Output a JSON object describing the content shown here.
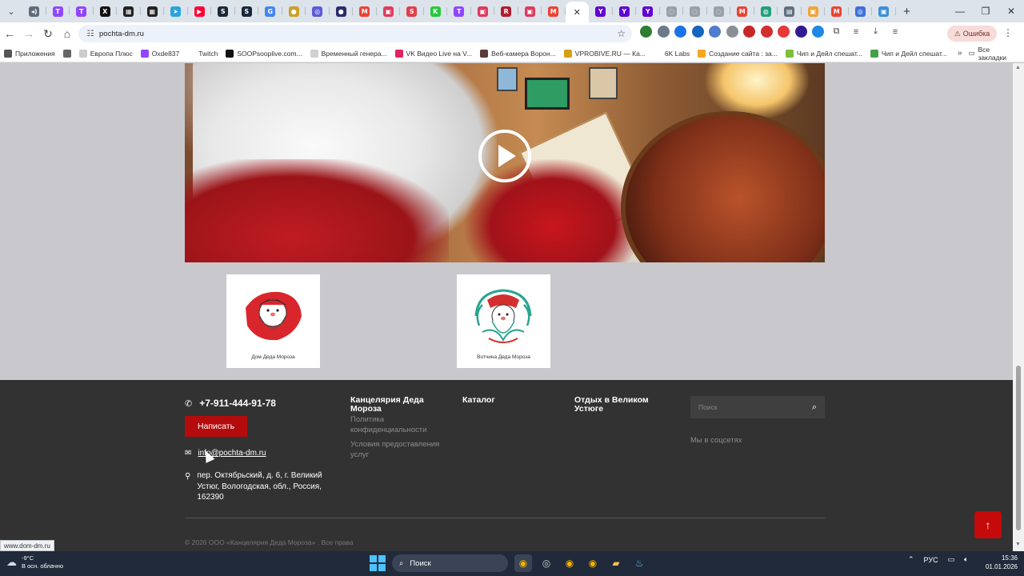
{
  "browser": {
    "url": "pochta-dm.ru",
    "errors_label": "Ошибка",
    "tabs": [
      {
        "icon": "audio-icon",
        "color": "#5f6b7a",
        "glyph": "◂)"
      },
      {
        "icon": "twitch-icon",
        "color": "#9146ff",
        "glyph": "T"
      },
      {
        "icon": "twitch-icon",
        "color": "#9146ff",
        "glyph": "T"
      },
      {
        "icon": "x-icon",
        "color": "#111111",
        "glyph": "X"
      },
      {
        "icon": "app-icon",
        "color": "#222222",
        "glyph": "▦"
      },
      {
        "icon": "app-icon",
        "color": "#222222",
        "glyph": "▦"
      },
      {
        "icon": "telegram-icon",
        "color": "#2aa3df",
        "glyph": "➤"
      },
      {
        "icon": "youtube-icon",
        "color": "#ff0033",
        "glyph": "▶"
      },
      {
        "icon": "steam-icon",
        "color": "#1b2838",
        "glyph": "S"
      },
      {
        "icon": "steam-icon",
        "color": "#1b2838",
        "glyph": "S"
      },
      {
        "icon": "google-icon",
        "color": "#4285f4",
        "glyph": "G"
      },
      {
        "icon": "coin-icon",
        "color": "#c9a227",
        "glyph": "●"
      },
      {
        "icon": "ring-icon",
        "color": "#5b5bd6",
        "glyph": "◎"
      },
      {
        "icon": "circle-icon",
        "color": "#2b2b6b",
        "glyph": "●"
      },
      {
        "icon": "gmail-icon",
        "color": "#ea4335",
        "glyph": "M"
      },
      {
        "icon": "app-icon",
        "color": "#e03a5c",
        "glyph": "▣"
      },
      {
        "icon": "app-icon",
        "color": "#e0404a",
        "glyph": "S"
      },
      {
        "icon": "kick-icon",
        "color": "#28c840",
        "glyph": "K"
      },
      {
        "icon": "twitch-icon",
        "color": "#9146ff",
        "glyph": "T"
      },
      {
        "icon": "app-icon",
        "color": "#e03a5c",
        "glyph": "▣"
      },
      {
        "icon": "app-icon",
        "color": "#b01e2e",
        "glyph": "R"
      },
      {
        "icon": "app-icon",
        "color": "#e03a5c",
        "glyph": "▣"
      },
      {
        "icon": "gmail-icon",
        "color": "#ea4335",
        "glyph": "M"
      },
      {
        "icon": "page-icon",
        "color": "#ffffff",
        "glyph": "",
        "active": true
      },
      {
        "icon": "yahoo-icon",
        "color": "#5f01d1",
        "glyph": "Y"
      },
      {
        "icon": "yahoo-icon",
        "color": "#5f01d1",
        "glyph": "Y"
      },
      {
        "icon": "yahoo-icon",
        "color": "#5f01d1",
        "glyph": "Y"
      },
      {
        "icon": "loading-icon",
        "color": "#9aa0a6",
        "glyph": "◌"
      },
      {
        "icon": "loading-icon",
        "color": "#9aa0a6",
        "glyph": "◌"
      },
      {
        "icon": "loading-icon",
        "color": "#9aa0a6",
        "glyph": "◌"
      },
      {
        "icon": "gmail-icon",
        "color": "#ea4335",
        "glyph": "M"
      },
      {
        "icon": "app-icon",
        "color": "#21a07a",
        "glyph": "◍"
      },
      {
        "icon": "app-icon",
        "color": "#607080",
        "glyph": "▤"
      },
      {
        "icon": "app-icon",
        "color": "#f2a33a",
        "glyph": "▣"
      },
      {
        "icon": "gmail-icon",
        "color": "#ea4335",
        "glyph": "M"
      },
      {
        "icon": "app-icon",
        "color": "#3b6fd8",
        "glyph": "◎"
      },
      {
        "icon": "app-icon",
        "color": "#3b8fd8",
        "glyph": "▣"
      }
    ],
    "extensions": [
      {
        "icon": "ext-green-icon",
        "color": "#2e7d32"
      },
      {
        "icon": "ext-translate-icon",
        "color": "#6d7a8a"
      },
      {
        "icon": "ext-blue-icon",
        "color": "#1a73e8"
      },
      {
        "icon": "ext-camera-icon",
        "color": "#1565c0"
      },
      {
        "icon": "ext-translator-icon",
        "color": "#4f7ccf"
      },
      {
        "icon": "ext-gray-icon",
        "color": "#8a8f96"
      },
      {
        "icon": "ext-red-icon",
        "color": "#c62828"
      },
      {
        "icon": "ext-pdf-icon",
        "color": "#d32f2f"
      },
      {
        "icon": "ext-red-circle-icon",
        "color": "#e53935"
      },
      {
        "icon": "ext-purple-icon",
        "color": "#311b92"
      },
      {
        "icon": "ext-blue-circle-icon",
        "color": "#1e88e5"
      }
    ],
    "bookmarks": [
      {
        "label": "Приложения",
        "icon": "apps-grid-icon",
        "color": "#555555"
      },
      {
        "label": "",
        "icon": "grid-icon",
        "color": "#666666"
      },
      {
        "label": "Европа Плюс",
        "icon": "radio-icon",
        "color": "#cccccc"
      },
      {
        "label": "Oxde837",
        "icon": "twitch-icon",
        "color": "#9146ff"
      },
      {
        "label": "Twitch",
        "icon": "twitch-icon",
        "color": "#ffffff"
      },
      {
        "label": "SOOPsooplive.com...",
        "icon": "soop-icon",
        "color": "#111111"
      },
      {
        "label": "Временный генера...",
        "icon": "doc-icon",
        "color": "#d0d0d0"
      },
      {
        "label": "VK Видео Live на V...",
        "icon": "vk-icon",
        "color": "#e0245e"
      },
      {
        "label": "Веб-камера Ворон...",
        "icon": "globe-icon",
        "color": "#5a3a3a"
      },
      {
        "label": "VPROBIVE.RU — Ка...",
        "icon": "key-icon",
        "color": "#d4a017"
      },
      {
        "label": "6K Labs",
        "icon": "blank-icon",
        "color": "#ffffff"
      },
      {
        "label": "Создание сайта : за...",
        "icon": "gear-icon",
        "color": "#f5a623"
      },
      {
        "label": "Чип и Дейл спешат...",
        "icon": "video-icon",
        "color": "#7cbf3a"
      },
      {
        "label": "Чип и Дейл спешат...",
        "icon": "check-icon",
        "color": "#43a047"
      }
    ],
    "all_bookmarks": "Все закладки"
  },
  "page": {
    "logos": [
      {
        "caption": "Дом Деда Мороза"
      },
      {
        "caption": "Вотчина Деда Мороза"
      }
    ],
    "footer": {
      "phone": "+7-911-444-91-78",
      "write_button": "Написать",
      "email": "info@pochta-dm.ru",
      "address": "пер. Октябрьский, д. 6, г. Великий Устюг, Вологодская, обл., Россия, 162390",
      "col1": {
        "title": "Канцелярия Деда Мороза",
        "links": [
          "Политика конфиденциальности",
          "Условия предоставления услуг"
        ]
      },
      "col2": {
        "title": "Каталог"
      },
      "col3": {
        "title": "Отдых в Великом Устюге"
      },
      "search_placeholder": "Поиск",
      "social": "Мы в соцсетях",
      "copyright": "© 2026 ООО «Канцелярия Деда Мороза» . Все права"
    }
  },
  "status_url": "www.dom-dm.ru",
  "taskbar": {
    "temperature": "-9°C",
    "weather": "В осн. облачно",
    "search": "Поиск",
    "language": "РУС",
    "time": "15:36",
    "date": "01.01.2026",
    "apps": [
      {
        "icon": "chrome-icon",
        "running": true
      },
      {
        "icon": "obs-icon",
        "running": false
      },
      {
        "icon": "chrome-icon",
        "running": false
      },
      {
        "icon": "chrome-icon",
        "running": false
      },
      {
        "icon": "folder-icon",
        "running": false
      },
      {
        "icon": "steam-icon",
        "running": false
      }
    ]
  }
}
